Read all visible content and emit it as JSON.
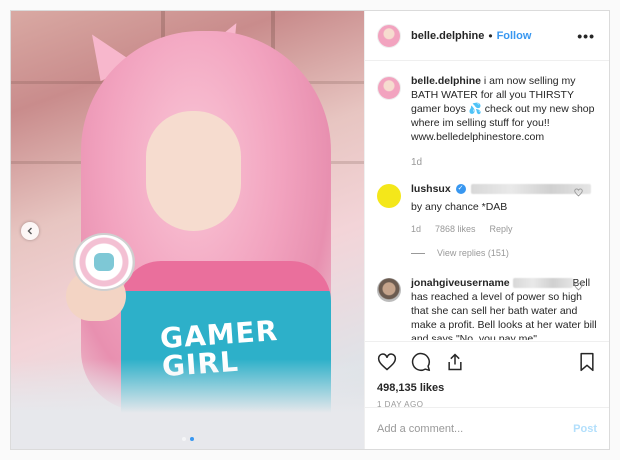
{
  "post": {
    "author": "belle.delphine",
    "separator": "•",
    "follow_label": "Follow",
    "more_icon": "more-horizontal-icon",
    "more_label": "•••",
    "media_text": "GAMER\nGIRL",
    "caption": {
      "user": "belle.delphine",
      "text": " i am now selling my BATH WATER for all you THIRSTY gamer boys 💦 check out my new shop where im selling stuff for you!! www.belledelphinestore.com",
      "time": "1d"
    },
    "comments": [
      {
        "user": "lushsux",
        "verified": true,
        "verified_glyph": "✓",
        "text": "by any chance *DAB",
        "time": "1d",
        "likes": "7868 likes",
        "reply": "Reply",
        "view_replies": "View replies (151)"
      },
      {
        "user": "jonahgiveusername",
        "verified": false,
        "text": "Bell has reached a level of power so high that she can sell her bath water and make a profit. Bell looks at her water bill and says \"No, you pay me\""
      }
    ],
    "likes": "498,135 likes",
    "posted_ago": "1 DAY AGO",
    "comment_input": {
      "value": "",
      "placeholder": "Add a comment..."
    },
    "post_label": "Post",
    "carousel": {
      "slides": 2,
      "active_index": 1
    }
  },
  "colors": {
    "accent": "#3897f0",
    "post_disabled": "#b2dffc",
    "muted": "#999999"
  }
}
